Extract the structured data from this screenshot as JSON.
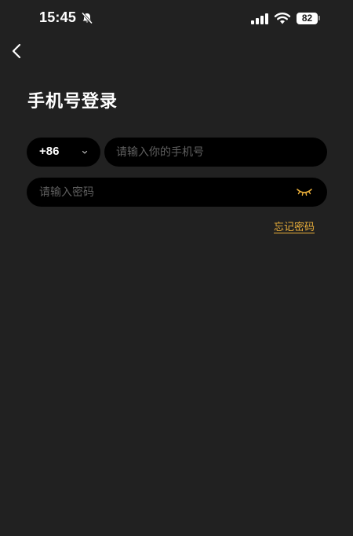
{
  "status_bar": {
    "time": "15:45",
    "battery_level": "82",
    "icons": [
      "bell-slash-icon",
      "cellular-signal-icon",
      "wifi-icon",
      "battery-icon"
    ]
  },
  "nav": {
    "back_icon": "chevron-left-icon"
  },
  "page": {
    "title": "手机号登录"
  },
  "form": {
    "country_code": "+86",
    "country_code_icon": "chevron-down-icon",
    "phone_placeholder": "请输入你的手机号",
    "phone_value": "",
    "password_placeholder": "请输入密码",
    "password_value": "",
    "password_toggle_icon": "eye-closed-icon",
    "forgot_password_label": "忘记密码"
  },
  "colors": {
    "background": "#212121",
    "input_background": "#000000",
    "accent": "#e9ae3a",
    "placeholder": "#5f5f5f"
  }
}
